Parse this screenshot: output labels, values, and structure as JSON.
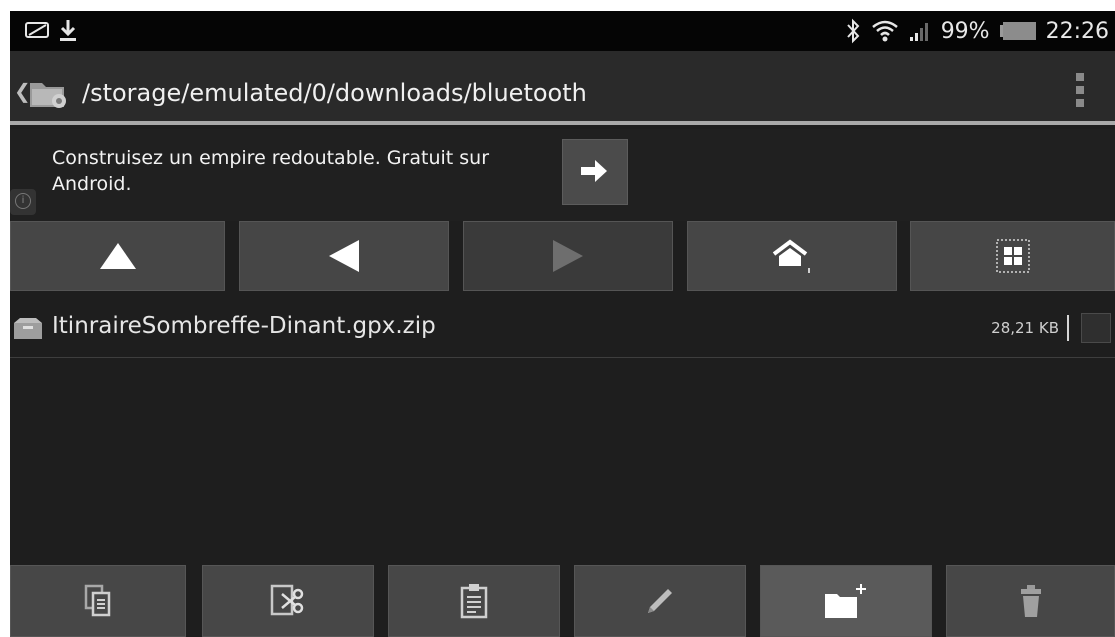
{
  "status_bar": {
    "icons": [
      "screenshot-icon",
      "download-icon",
      "bluetooth-icon",
      "wifi-icon",
      "signal-icon",
      "battery-icon"
    ],
    "battery": "99%",
    "time": "22:26"
  },
  "path_bar": {
    "path": "/storage/emulated/0/downloads/bluetooth",
    "icons": [
      "back-chevron-icon",
      "folder-app-icon",
      "overflow-menu-icon"
    ]
  },
  "ad": {
    "text": "Construisez un empire redoutable. Gratuit sur Android.",
    "icons": [
      "info-icon",
      "arrow-right-icon"
    ]
  },
  "nav_buttons": [
    "up-icon",
    "back-icon",
    "forward-icon",
    "home-icon",
    "grid-view-icon"
  ],
  "files": [
    {
      "name": "ItinraireSombreffe-Dinant.gpx.zip",
      "size": "28,21 KB",
      "icon": "archive-icon",
      "checked": false
    }
  ],
  "toolbar": [
    "copy-icon",
    "cut-icon",
    "paste-icon",
    "rename-icon",
    "new-folder-icon",
    "delete-icon"
  ],
  "colors": {
    "background": "#1e1e1e",
    "button": "#474747",
    "status_bar": "#050505"
  }
}
